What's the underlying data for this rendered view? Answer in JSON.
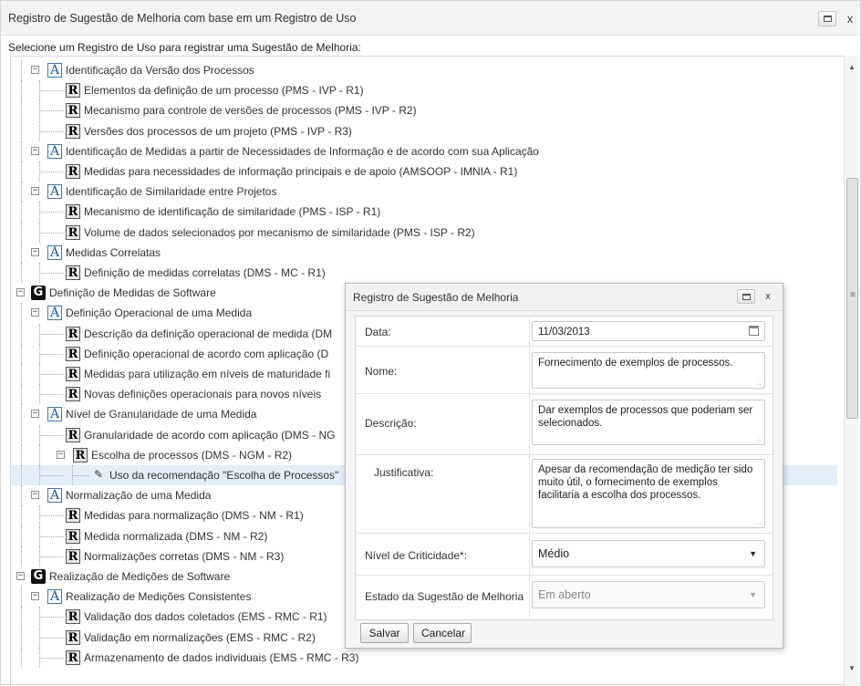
{
  "window": {
    "title": "Registro de Sugestão de Melhoria com base em um Registro de Uso",
    "maximize_icon": "maximize-icon",
    "close_symbol": "x"
  },
  "instruction": "Selecione um Registro de Uso para registrar uma Sugestão de Melhoria:",
  "tree": {
    "rows": [
      {
        "level": 1,
        "icon": "A",
        "expander": "−",
        "label": "Identificação da Versão dos Processos"
      },
      {
        "level": 2,
        "icon": "R",
        "expander": "",
        "label": "Elementos da definição de um processo (PMS - IVP - R1)"
      },
      {
        "level": 2,
        "icon": "R",
        "expander": "",
        "label": "Mecanismo para controle de versões de processos (PMS - IVP - R2)"
      },
      {
        "level": 2,
        "icon": "R",
        "expander": "",
        "label": "Versões dos processos de um projeto (PMS - IVP - R3)"
      },
      {
        "level": 1,
        "icon": "A",
        "expander": "−",
        "label": "Identificação de Medidas a partir de Necessidades de Informação e de acordo com sua Aplicação"
      },
      {
        "level": 2,
        "icon": "R",
        "expander": "",
        "label": "Medidas para necessidades de informação principais e de apoio (AMSOOP - IMNIA - R1)"
      },
      {
        "level": 1,
        "icon": "A",
        "expander": "−",
        "label": "Identificação de Similaridade entre Projetos"
      },
      {
        "level": 2,
        "icon": "R",
        "expander": "",
        "label": "Mecanismo de identificação de similaridade (PMS - ISP - R1)"
      },
      {
        "level": 2,
        "icon": "R",
        "expander": "",
        "label": "Volume de dados selecionados por mecanismo de similaridade (PMS - ISP - R2)"
      },
      {
        "level": 1,
        "icon": "A",
        "expander": "−",
        "label": "Medidas Correlatas"
      },
      {
        "level": 2,
        "icon": "R",
        "expander": "",
        "label": "Definição de medidas correlatas (DMS - MC - R1)"
      },
      {
        "level": 0,
        "icon": "G",
        "expander": "−",
        "label": "Definição de Medidas de Software"
      },
      {
        "level": 1,
        "icon": "A",
        "expander": "−",
        "label": "Definição Operacional de uma Medida"
      },
      {
        "level": 2,
        "icon": "R",
        "expander": "",
        "label": "Descrição da definição operacional de medida (DM"
      },
      {
        "level": 2,
        "icon": "R",
        "expander": "",
        "label": "Definição operacional de acordo com aplicação (D"
      },
      {
        "level": 2,
        "icon": "R",
        "expander": "",
        "label": "Medidas para utilização em níveis de maturidade fi"
      },
      {
        "level": 2,
        "icon": "R",
        "expander": "",
        "label": "Novas definições operacionais para novos níveis"
      },
      {
        "level": 1,
        "icon": "A",
        "expander": "−",
        "label": "Nível de Granularidade de uma Medida"
      },
      {
        "level": 2,
        "icon": "R",
        "expander": "",
        "label": "Granularidade de acordo com aplicação (DMS - NG"
      },
      {
        "level": 2,
        "icon": "R",
        "expander": "−",
        "label": "Escolha de processos (DMS - NGM - R2)"
      },
      {
        "level": 3,
        "icon": "E",
        "expander": "",
        "label": "Uso da recomendação \"Escolha de Processos\"",
        "selected": true
      },
      {
        "level": 1,
        "icon": "A",
        "expander": "−",
        "label": "Normalização de uma Medida"
      },
      {
        "level": 2,
        "icon": "R",
        "expander": "",
        "label": "Medidas para normalização (DMS - NM - R1)"
      },
      {
        "level": 2,
        "icon": "R",
        "expander": "",
        "label": "Medida normalizada (DMS - NM - R2)"
      },
      {
        "level": 2,
        "icon": "R",
        "expander": "",
        "label": "Normalizações corretas (DMS - NM - R3)"
      },
      {
        "level": 0,
        "icon": "G",
        "expander": "−",
        "label": "Realização de Medições de Software"
      },
      {
        "level": 1,
        "icon": "A",
        "expander": "−",
        "label": "Realização de Medições Consistentes"
      },
      {
        "level": 2,
        "icon": "R",
        "expander": "",
        "label": "Validação dos dados coletados (EMS - RMC - R1)"
      },
      {
        "level": 2,
        "icon": "R",
        "expander": "",
        "label": "Validação em normalizações (EMS - RMC - R2)"
      },
      {
        "level": 2,
        "icon": "R",
        "expander": "",
        "label": "Armazenamento de dados individuais (EMS - RMC - R3)"
      }
    ]
  },
  "dialog": {
    "title": "Registro de Sugestão de Melhoria",
    "close_symbol": "x",
    "fields": {
      "data": {
        "label": "Data:",
        "value": "11/03/2013"
      },
      "nome": {
        "label": "Nome:",
        "value": "Fornecimento de exemplos de processos."
      },
      "descricao": {
        "label": "Descrição:",
        "value": "Dar exemplos de processos que poderiam ser selecionados."
      },
      "justificativa": {
        "label": "Justificativa:",
        "value": "Apesar da recomendação de medição ter sido muito útil, o fornecimento de exemplos facilitaria a escolha dos processos."
      },
      "criticidade": {
        "label": "Nível de Criticidade*:",
        "value": "Médio"
      },
      "estado": {
        "label": "Estado da Sugestão de Melhoria",
        "value": "Em aberto"
      }
    },
    "buttons": {
      "salvar": "Salvar",
      "cancelar": "Cancelar"
    }
  },
  "colors": {
    "selection": "#e3eef9",
    "accent_blue": "#1f5fa6"
  }
}
